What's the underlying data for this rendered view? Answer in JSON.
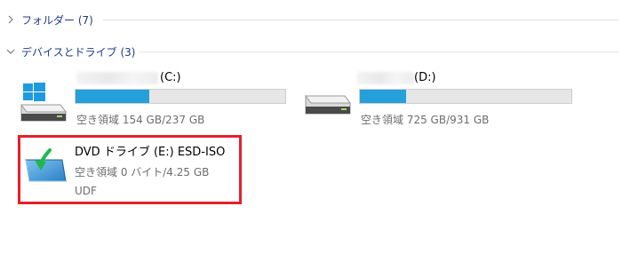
{
  "groups": {
    "folders": {
      "label": "フォルダー (7)",
      "expanded": false
    },
    "devices": {
      "label": "デバイスとドライブ (3)",
      "expanded": true
    }
  },
  "drives": [
    {
      "id": "c",
      "name": "(C:)",
      "icon": "windows-drive-icon",
      "space_text": "空き領域 154 GB/237 GB",
      "used_fraction": 0.35,
      "bar_color": "#26a0da"
    },
    {
      "id": "d",
      "name": "(D:)",
      "icon": "hard-drive-icon",
      "space_text": "空き領域 725 GB/931 GB",
      "used_fraction": 0.22,
      "bar_color": "#26a0da"
    },
    {
      "id": "e",
      "name": "DVD ドライブ (E:) ESD-ISO",
      "icon": "dvd-drive-icon",
      "space_text": "空き領域 0 バイト/4.25 GB",
      "filesystem": "UDF",
      "highlight_color": "#e5202a"
    }
  ]
}
